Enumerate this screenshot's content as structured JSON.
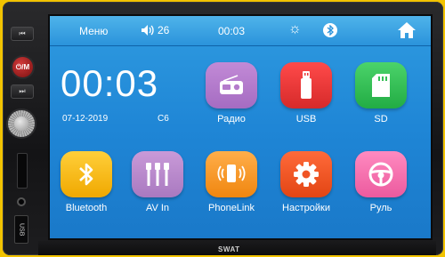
{
  "topbar": {
    "menu_label": "Меню",
    "volume_value": "26",
    "time": "00:03"
  },
  "clock": {
    "time": "00:03",
    "date": "07-12-2019",
    "weekday": "C6"
  },
  "tiles": [
    {
      "label": "Радио",
      "icon": "radio-icon",
      "color": "#b47ccc"
    },
    {
      "label": "USB",
      "icon": "usb-icon",
      "color": "#e83636"
    },
    {
      "label": "SD",
      "icon": "sd-card-icon",
      "color": "#33c055"
    },
    {
      "label": "Bluetooth",
      "icon": "bluetooth-icon",
      "color": "#f7bd1c"
    },
    {
      "label": "AV In",
      "icon": "av-in-icon",
      "color": "#b889cc"
    },
    {
      "label": "PhoneLink",
      "icon": "phonelink-icon",
      "color": "#f7981f"
    },
    {
      "label": "Настройки",
      "icon": "gear-icon",
      "color": "#f05424"
    },
    {
      "label": "Руль",
      "icon": "steering-wheel-icon",
      "color": "#f572ae"
    }
  ],
  "side_panel": {
    "usb_label": "USB"
  },
  "brand": "SWAT",
  "colors": {
    "screen_bg": "#2a8fdc",
    "bezel": "#1a1a1c",
    "background": "#f2c300"
  }
}
